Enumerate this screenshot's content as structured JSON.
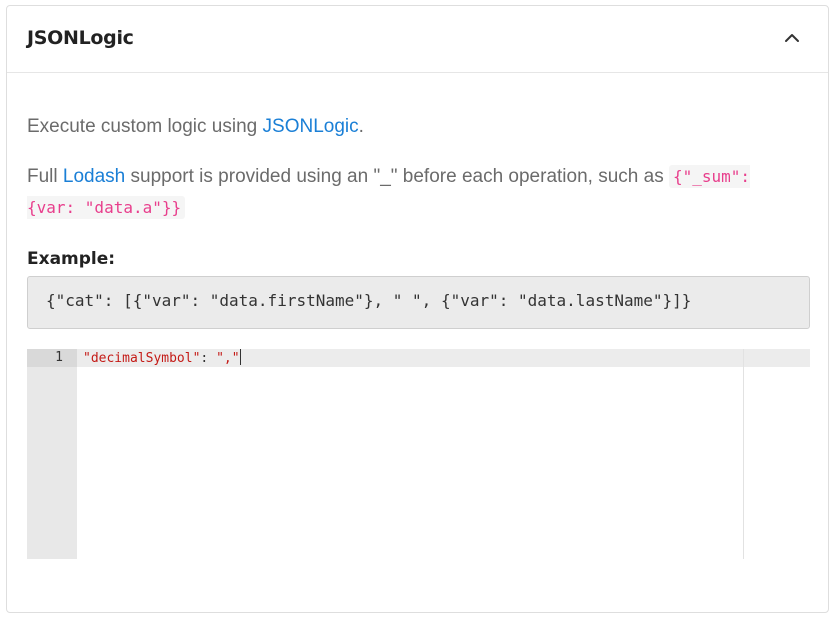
{
  "panel": {
    "title": "JSONLogic",
    "collapse_icon": "chevron-up-icon"
  },
  "description": {
    "line1_prefix": "Execute custom logic using ",
    "line1_link": "JSONLogic",
    "line1_suffix": ".",
    "line2_prefix": "Full ",
    "line2_link": "Lodash",
    "line2_middle": " support is provided using an \"_\" before each operation, such as ",
    "line2_code": "{\"_sum\": {var: \"data.a\"}}"
  },
  "example": {
    "label": "Example:",
    "code": "{\"cat\": [{\"var\": \"data.firstName\"}, \" \", {\"var\": \"data.lastName\"}]}"
  },
  "editor": {
    "lines": [
      {
        "number": "1",
        "key": "\"decimalSymbol\"",
        "separator": ": ",
        "value": "\",\""
      }
    ]
  },
  "colors": {
    "link": "#1a7fd6",
    "inline_code": "#e83e8c",
    "editor_string": "#c41a16"
  }
}
